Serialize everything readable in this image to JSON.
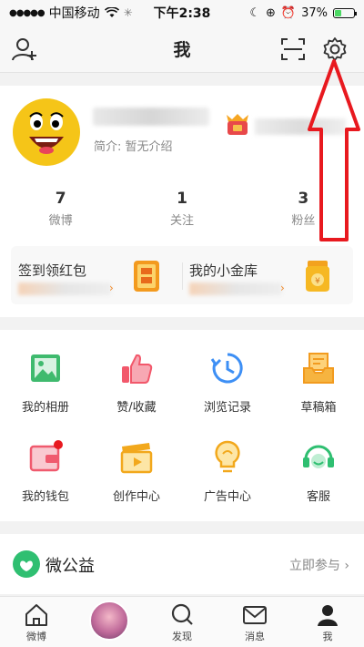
{
  "status_bar": {
    "carrier": "中国移动",
    "time": "下午2:38",
    "battery": "37%",
    "battery_level": 0.37
  },
  "nav": {
    "title": "我",
    "add_friend_icon": "add-user-icon",
    "scan_icon": "scan-icon",
    "settings_icon": "gear-icon"
  },
  "profile": {
    "bio": "简介: 暂无介绍",
    "stats": [
      {
        "value": "7",
        "label": "微博"
      },
      {
        "value": "1",
        "label": "关注"
      },
      {
        "value": "3",
        "label": "粉丝"
      }
    ]
  },
  "promo": {
    "left_title": "签到领红包",
    "right_title": "我的小金库"
  },
  "grid": [
    {
      "label": "我的相册",
      "icon": "photo-album-icon"
    },
    {
      "label": "赞/收藏",
      "icon": "thumbs-up-icon"
    },
    {
      "label": "浏览记录",
      "icon": "history-clock-icon"
    },
    {
      "label": "草稿箱",
      "icon": "drafts-tray-icon"
    },
    {
      "label": "我的钱包",
      "icon": "wallet-icon"
    },
    {
      "label": "创作中心",
      "icon": "clapperboard-icon"
    },
    {
      "label": "广告中心",
      "icon": "lightbulb-icon"
    },
    {
      "label": "客服",
      "icon": "headset-icon"
    }
  ],
  "charity": {
    "title": "微公益",
    "link": "立即参与 ›"
  },
  "tabs": [
    {
      "label": "微博",
      "icon": "home-icon"
    },
    {
      "label": "",
      "icon": "avatar"
    },
    {
      "label": "发现",
      "icon": "search-icon"
    },
    {
      "label": "消息",
      "icon": "mail-icon"
    },
    {
      "label": "我",
      "icon": "profile-icon"
    }
  ],
  "colors": {
    "accent_orange": "#f08a2c",
    "annotation_red": "#e8191f",
    "charity_green": "#2fbf71"
  }
}
